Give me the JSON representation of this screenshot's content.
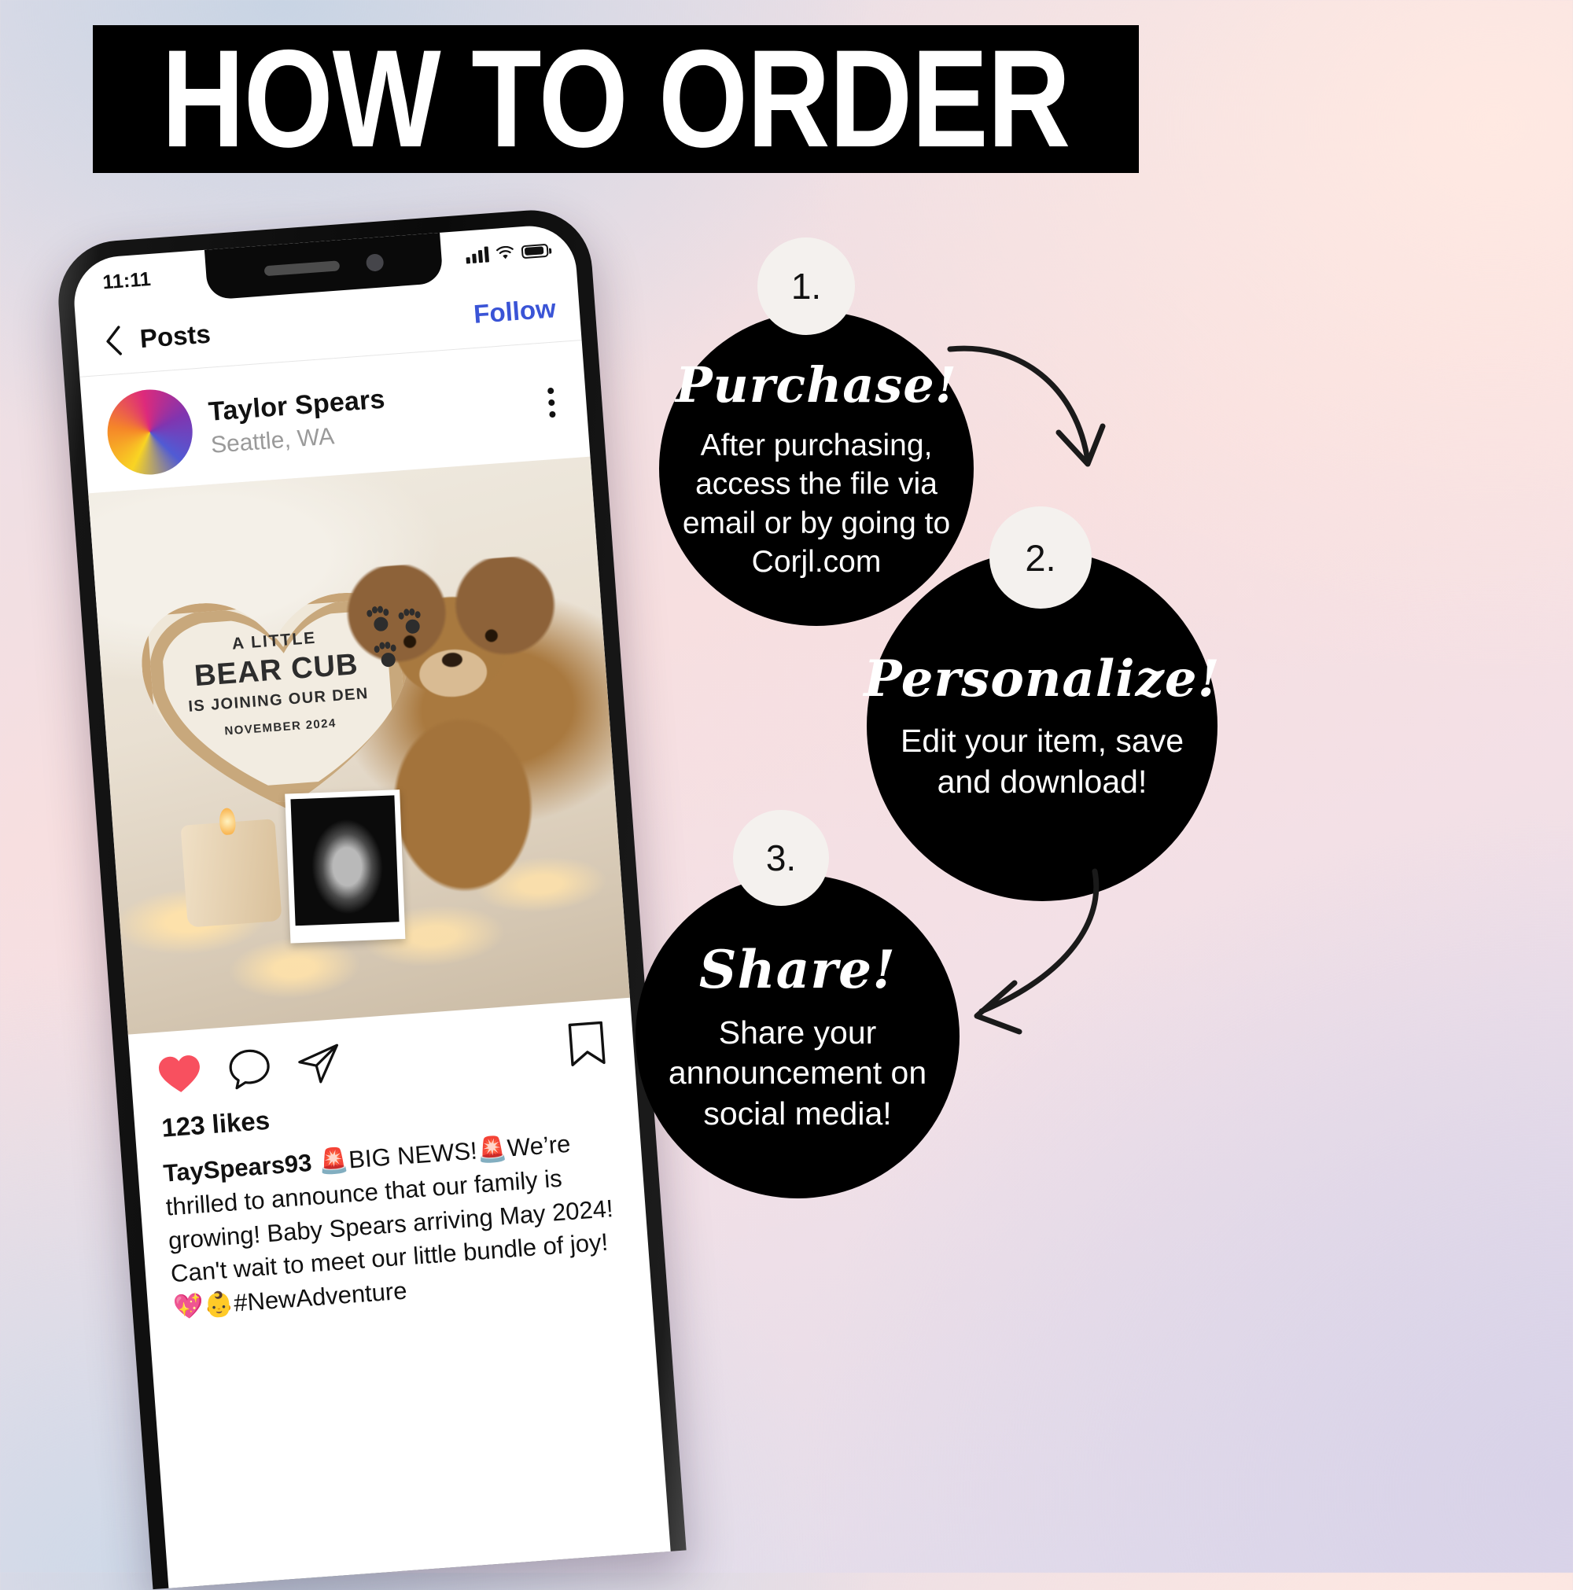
{
  "header": {
    "title": "HOW TO ORDER"
  },
  "phone": {
    "status": {
      "time": "11:11",
      "signal_icon": "cellular-bars-icon",
      "wifi_icon": "wifi-icon",
      "battery_icon": "battery-icon"
    },
    "nav": {
      "back_icon": "chevron-left-icon",
      "title": "Posts",
      "follow_label": "Follow"
    },
    "post": {
      "username": "Taylor Spears",
      "location": "Seattle, WA",
      "more_icon": "kebab-menu-icon",
      "photo": {
        "sign_line1": "A LITTLE",
        "sign_line2": "BEAR CUB",
        "sign_line3": "IS JOINING OUR DEN",
        "sign_line4": "NOVEMBER 2024"
      },
      "actions": {
        "like_icon": "heart-icon",
        "comment_icon": "comment-bubble-icon",
        "share_icon": "paper-plane-icon",
        "save_icon": "bookmark-icon"
      },
      "likes": "123 likes",
      "caption_handle": "TaySpears93",
      "caption_text": " 🚨BIG NEWS!🚨We’re thrilled to announce that our family is growing! Baby Spears arriving May 2024! Can't wait to meet our little bundle of joy! 💖👶#NewAdventure"
    }
  },
  "steps": [
    {
      "number": "1.",
      "title": "Purchase!",
      "body": "After purchasing, access the file via email or by going to Corjl.com"
    },
    {
      "number": "2.",
      "title": "Personalize!",
      "body": "Edit your item, save and download!"
    },
    {
      "number": "3.",
      "title": "Share!",
      "body": "Share your announcement on social media!"
    }
  ],
  "colors": {
    "banner_bg": "#000000",
    "banner_text": "#ffffff",
    "step_bg": "#000000",
    "badge_bg": "#f4f1ee",
    "follow_link": "#3a54d6",
    "like_red": "#f8505f"
  }
}
